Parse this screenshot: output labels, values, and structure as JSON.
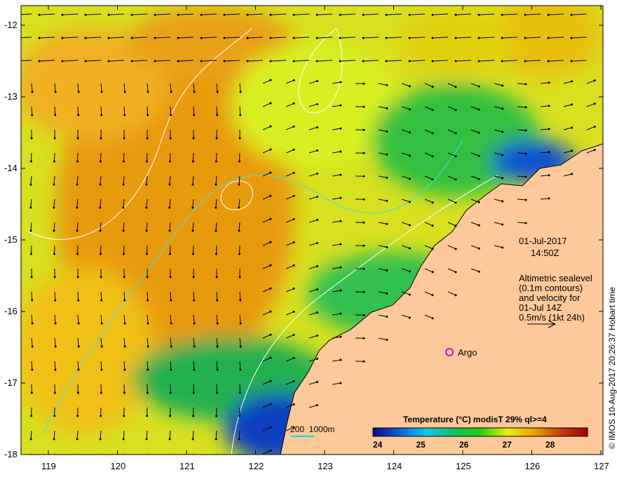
{
  "map": {
    "date": "01-Jul-2017",
    "time": "14:50Z",
    "altimetry_note": [
      "Altimetric sealevel",
      "(0.1m contours)",
      "and velocity for",
      "01-Jul 14Z",
      "0.5m/s (1kt 24h)"
    ],
    "argo_label": "Argo",
    "scale_bar_label": "200  1000m",
    "credit": "© IMOS 10-Aug-2017 20:26:37 Hobart time",
    "lat_ticks": [
      "-12",
      "-13",
      "-14",
      "-15",
      "-16",
      "-17",
      "-18"
    ],
    "lon_ticks": [
      "119",
      "120",
      "121",
      "122",
      "123",
      "124",
      "125",
      "126",
      "127"
    ],
    "colorbar": {
      "title": "Temperature (°C) modisT 29% ql>=4",
      "ticks": [
        "24",
        "25",
        "26",
        "27",
        "28"
      ],
      "colors": [
        "#0a0a80",
        "#1060e0",
        "#10c8e8",
        "#10c060",
        "#20d010",
        "#e8f010",
        "#f0a000",
        "#c04010",
        "#a00000"
      ]
    },
    "colors": {
      "land": "#fdc99a",
      "argo": "#e000e0",
      "contour": "#ffffff",
      "isobath": "#40e0f0"
    }
  }
}
